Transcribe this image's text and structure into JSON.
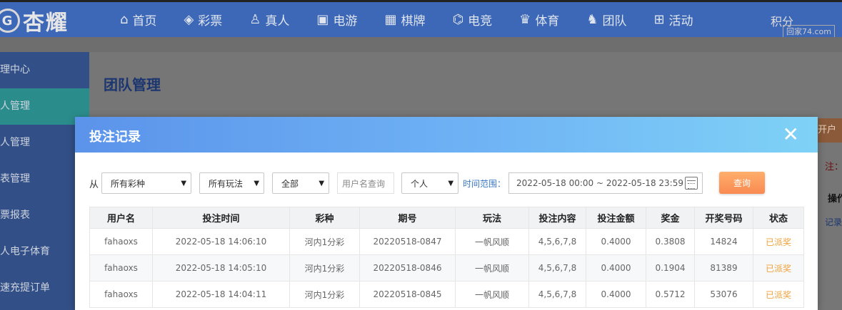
{
  "logo": {
    "text": "杏耀"
  },
  "nav": {
    "items": [
      {
        "label": "首页",
        "icon": "home-icon",
        "glyph": "⌂"
      },
      {
        "label": "彩票",
        "icon": "ticket-icon",
        "glyph": "◈"
      },
      {
        "label": "真人",
        "icon": "person-icon",
        "glyph": "♙"
      },
      {
        "label": "电游",
        "icon": "slot-machine-icon",
        "glyph": "▣"
      },
      {
        "label": "棋牌",
        "icon": "cards-icon",
        "glyph": "▦"
      },
      {
        "label": "电竞",
        "icon": "gamepad-icon",
        "glyph": "⌬"
      },
      {
        "label": "体育",
        "icon": "trophy-icon",
        "glyph": "♛"
      },
      {
        "label": "团队",
        "icon": "team-icon",
        "glyph": "♞"
      },
      {
        "label": "活动",
        "icon": "gift-icon",
        "glyph": "⊞"
      }
    ],
    "extra_label": "积分",
    "watermark": "回家74.com"
  },
  "sidebar": {
    "items": [
      {
        "label": "理中心",
        "active": false
      },
      {
        "label": "人管理",
        "active": true
      },
      {
        "label": "人管理",
        "active": false
      },
      {
        "label": "表管理",
        "active": false
      },
      {
        "label": "票报表",
        "active": false
      },
      {
        "label": "人电子体育",
        "active": false
      },
      {
        "label": "速充提订单",
        "active": false
      }
    ]
  },
  "page": {
    "title": "团队管理",
    "right_tab": "开户",
    "right_note": "注：",
    "right_header": "操作",
    "right_link": "记录"
  },
  "modal": {
    "title": "投注记录",
    "close_glyph": "✕",
    "filters": {
      "from_label": "从",
      "lottery": "所有彩种",
      "play": "所有玩法",
      "scope": "全部",
      "username_placeholder": "用户名查询",
      "user_type": "个人",
      "time_label": "时间范围：",
      "date_range": "2022-05-18 00:00 ~ 2022-05-18 23:59",
      "query_button": "查询"
    },
    "table": {
      "headers": [
        "用户名",
        "投注时间",
        "彩种",
        "期号",
        "玩法",
        "投注内容",
        "投注金额",
        "奖金",
        "开奖号码",
        "状态"
      ],
      "rows": [
        [
          "fahaoxs",
          "2022-05-18 14:06:10",
          "河内1分彩",
          "20220518-0847",
          "一帆风顺",
          "4,5,6,7,8",
          "0.4000",
          "0.3808",
          "14824",
          "已派奖"
        ],
        [
          "fahaoxs",
          "2022-05-18 14:05:10",
          "河内1分彩",
          "20220518-0846",
          "一帆风顺",
          "4,5,6,7,8",
          "0.4000",
          "0.1904",
          "81389",
          "已派奖"
        ],
        [
          "fahaoxs",
          "2022-05-18 14:04:11",
          "河内1分彩",
          "20220518-0845",
          "一帆风顺",
          "4,5,6,7,8",
          "0.4000",
          "0.5712",
          "53076",
          "已派奖"
        ]
      ]
    }
  },
  "colors": {
    "nav_bg": "#3d67b7",
    "sidebar_bg": "#324f87",
    "sidebar_active": "#2b8c8c",
    "modal_header_start": "#5b93ea",
    "modal_header_end": "#7fd2f6",
    "query_button": "#f98a52",
    "status_paid": "#f2a13a"
  }
}
